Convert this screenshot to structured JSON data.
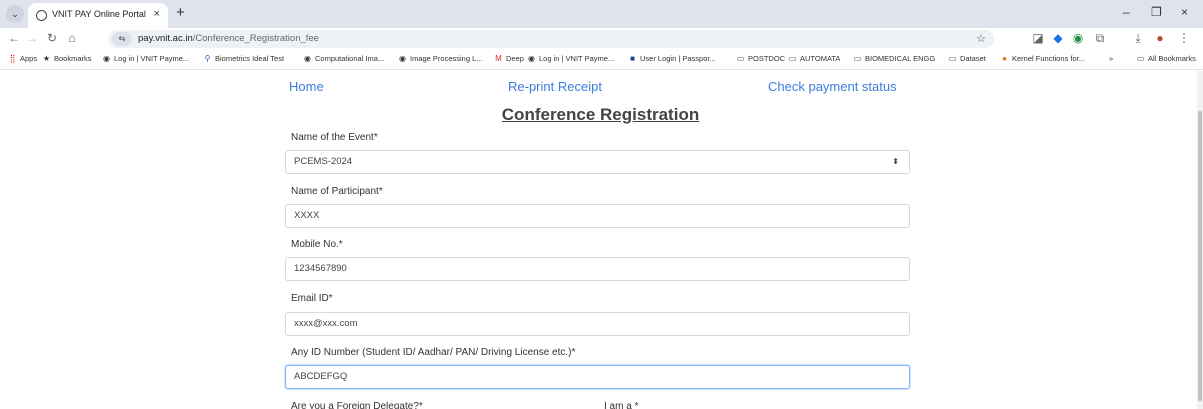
{
  "browser": {
    "tab_title": "VNIT PAY Online Portal",
    "url_domain": "pay.vnit.ac.in",
    "url_path": "/Conference_Registration_fee",
    "new_tab_label": "+",
    "close_label": "×",
    "minimize_label": "–",
    "restore_label": "❐",
    "window_close_label": "×"
  },
  "bookmarks": [
    {
      "label": "Apps",
      "icon": "apps-icon"
    },
    {
      "label": "Bookmarks",
      "icon": "star-icon"
    },
    {
      "label": "Log in | VNIT Payme...",
      "icon": "globe-icon"
    },
    {
      "label": "Biometrics Ideal Test",
      "icon": "bio-icon"
    },
    {
      "label": "Computational Ima...",
      "icon": "globe-icon"
    },
    {
      "label": "Image Processing L...",
      "icon": "globe-icon"
    },
    {
      "label": "Deep",
      "icon": "gmail-icon"
    },
    {
      "label": "Log in | VNIT Payme...",
      "icon": "globe-icon"
    },
    {
      "label": "User Login | Passpor...",
      "icon": "passport-icon"
    },
    {
      "label": "POSTDOC",
      "icon": "folder-icon"
    },
    {
      "label": "AUTOMATA",
      "icon": "folder-icon"
    },
    {
      "label": "BIOMEDICAL ENGG",
      "icon": "folder-icon"
    },
    {
      "label": "Dataset",
      "icon": "folder-icon"
    },
    {
      "label": "Kernel Functions for...",
      "icon": "kernel-icon"
    },
    {
      "label": "»",
      "icon": ""
    },
    {
      "label": "All Bookmarks",
      "icon": "folder-icon"
    }
  ],
  "nav": {
    "home": "Home",
    "reprint": "Re-print Receipt",
    "check_status": "Check payment status"
  },
  "form": {
    "title": "Conference Registration",
    "event_label": "Name of the Event*",
    "event_value": "PCEMS-2024",
    "participant_label": "Name of Participant*",
    "participant_value": "XXXX",
    "mobile_label": "Mobile No.*",
    "mobile_value": "1234567890",
    "email_label": "Email ID*",
    "email_value": "xxxx@xxx.com",
    "id_label": "Any ID Number (Student ID/ Aadhar/ PAN/ Driving License etc.)*",
    "id_value": "ABCDEFGQ",
    "foreign_label": "Are you a Foreign Delegate?*",
    "iam_label": "I am a *"
  },
  "colors": {
    "link": "#3b7ddd",
    "focus_border": "#86b7fe"
  }
}
